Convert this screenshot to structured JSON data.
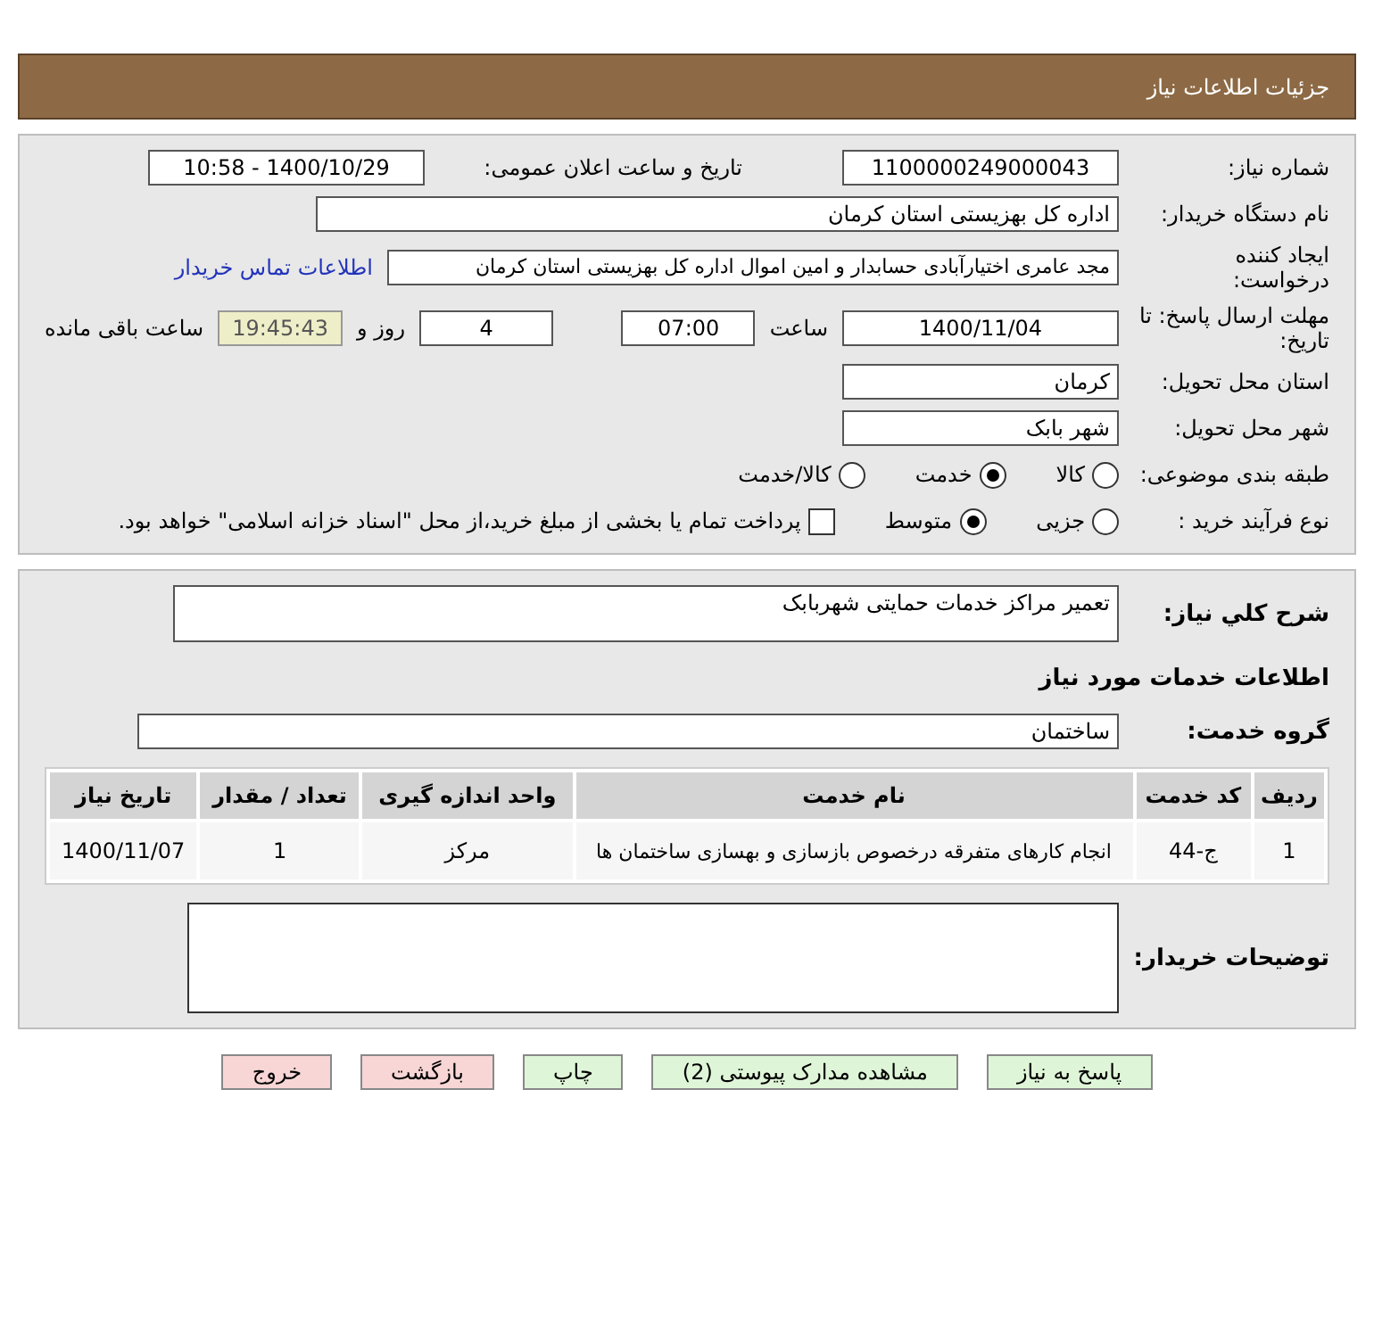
{
  "header": {
    "title": "جزئیات اطلاعات نیاز"
  },
  "details": {
    "need_number": {
      "label": "شماره نیاز:",
      "value": "1100000249000043"
    },
    "announce": {
      "label": "تاریخ و ساعت اعلان عمومی:",
      "value": "1400/10/29 - 10:58"
    },
    "buyer": {
      "label": "نام دستگاه خریدار:",
      "value": "اداره کل بهزیستی استان کرمان"
    },
    "creator": {
      "label": "ایجاد کننده درخواست:",
      "value": "مجد عامری اختیارآبادی حسابدار و امین اموال اداره کل بهزیستی استان کرمان",
      "link": "اطلاعات تماس خریدار"
    },
    "deadline": {
      "label": "مهلت ارسال پاسخ: تا تاریخ:",
      "date": "1400/11/04",
      "time_label": "ساعت",
      "time": "07:00",
      "days": "4",
      "days_label": "روز و",
      "remaining": "19:45:43",
      "remaining_label": "ساعت باقی مانده"
    },
    "province": {
      "label": "استان محل تحویل:",
      "value": "کرمان"
    },
    "city": {
      "label": "شهر محل تحویل:",
      "value": "شهر بابک"
    },
    "category": {
      "label": "طبقه بندی موضوعی:",
      "options": [
        {
          "label": "کالا",
          "selected": false
        },
        {
          "label": "خدمت",
          "selected": true
        },
        {
          "label": "کالا/خدمت",
          "selected": false
        }
      ]
    },
    "process": {
      "label": "نوع فرآیند خرید :",
      "options": [
        {
          "label": "جزیی",
          "selected": false
        },
        {
          "label": "متوسط",
          "selected": true
        }
      ],
      "payment": {
        "label": "پرداخت تمام یا بخشی از مبلغ خرید،از محل \"اسناد خزانه اسلامی\" خواهد بود.",
        "checked": false
      }
    }
  },
  "summary": {
    "label": "شرح کلي نياز:",
    "value": "تعمیر مراکز خدمات حمایتی شهربابک"
  },
  "services_title": "اطلاعات خدمات مورد نیاز",
  "service_group": {
    "label": "گروه خدمت:",
    "value": "ساختمان"
  },
  "table": {
    "columns": [
      "ردیف",
      "کد خدمت",
      "نام خدمت",
      "واحد اندازه گیری",
      "تعداد / مقدار",
      "تاریخ نیاز"
    ],
    "rows": [
      [
        "1",
        "ج-44",
        "انجام کارهای متفرقه درخصوص بازسازی و بهسازی ساختمان ها",
        "مرکز",
        "1",
        "1400/11/07"
      ]
    ]
  },
  "buyer_notes": {
    "label": "توضیحات خریدار:"
  },
  "buttons": [
    {
      "label": "پاسخ به نیاز",
      "kind": "green"
    },
    {
      "label": "مشاهده مدارک پیوستی (2)",
      "kind": "green"
    },
    {
      "label": "چاپ",
      "kind": "green"
    },
    {
      "label": "بازگشت",
      "kind": "red"
    },
    {
      "label": "خروج",
      "kind": "red"
    }
  ]
}
